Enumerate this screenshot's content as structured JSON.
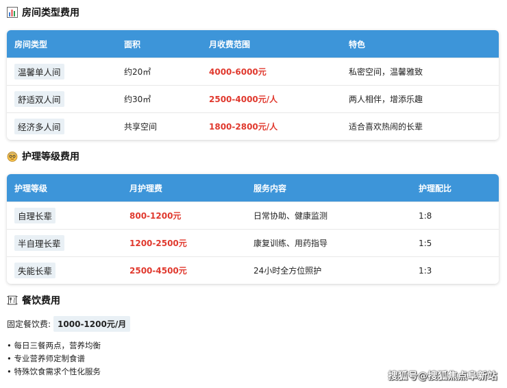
{
  "room_section": {
    "icon": "bar-chart-icon",
    "title": "房间类型费用",
    "headers": [
      "房间类型",
      "面积",
      "月收费范围",
      "特色"
    ],
    "rows": [
      {
        "type": "温馨单人间",
        "area": "约20㎡",
        "price": "4000-6000元",
        "feature": "私密空间，温馨雅致"
      },
      {
        "type": "舒适双人间",
        "area": "约30㎡",
        "price": "2500-4000元/人",
        "feature": "两人相伴，增添乐趣"
      },
      {
        "type": "经济多人间",
        "area": "共享空间",
        "price": "1800-2800元/人",
        "feature": "适合喜欢热闹的长辈"
      }
    ]
  },
  "care_section": {
    "icon": "elderly-face-icon",
    "title": "护理等级费用",
    "headers": [
      "护理等级",
      "月护理费",
      "服务内容",
      "护理配比"
    ],
    "rows": [
      {
        "level": "自理长辈",
        "price": "800-1200元",
        "service": "日常协助、健康监测",
        "ratio": "1:8"
      },
      {
        "level": "半自理长辈",
        "price": "1200-2500元",
        "service": "康复训练、用药指导",
        "ratio": "1:5"
      },
      {
        "level": "失能长辈",
        "price": "2500-4500元",
        "service": "24小时全方位照护",
        "ratio": "1:3"
      }
    ]
  },
  "meal_section": {
    "icon": "dining-icon",
    "title": "餐饮费用",
    "fee_label": "固定餐饮费:",
    "fee_value": "1000-1200元/月",
    "bullets": [
      "每日三餐两点，营养均衡",
      "专业营养师定制食谱",
      "特殊饮食需求个性化服务"
    ]
  },
  "watermark": "搜狐号@搜狐焦点阜新站",
  "colors": {
    "header_bg": "#3d95d9",
    "price": "#e0392e",
    "tag_bg": "#e9f0f5"
  }
}
